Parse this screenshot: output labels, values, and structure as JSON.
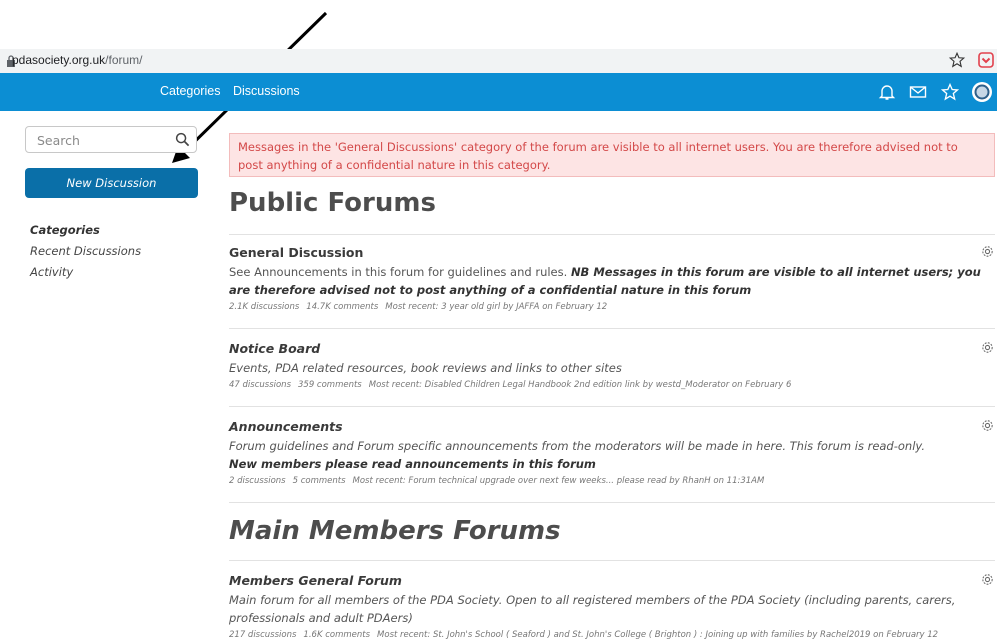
{
  "browser": {
    "url_domain": "pdasociety.org.uk",
    "url_path": "/forum/",
    "lock_icon": "lock-icon",
    "bookmark_icon": "star-outline-icon",
    "extension_icon": "pocket-icon"
  },
  "nav": {
    "categories": "Categories",
    "discussions": "Discussions",
    "icons": [
      "bell-icon",
      "envelope-icon",
      "star-icon",
      "avatar-icon"
    ],
    "bg_color": "#0c8ed3"
  },
  "sidebar": {
    "search_placeholder": "Search",
    "new_discussion": "New Discussion",
    "links": [
      "Categories",
      "Recent Discussions",
      "Activity"
    ],
    "active_link": "Categories"
  },
  "alert": {
    "text": "Messages in the 'General Discussions' category of the forum are visible to all internet users. You are therefore advised not to post anything of a confidential nature in this category."
  },
  "sections": [
    {
      "title": "Public Forums",
      "categories": [
        {
          "title": "General Discussion",
          "desc_plain": "See Announcements in this forum for guidelines and rules. ",
          "desc_bold": "NB Messages in this forum are visible to all internet users; you are therefore advised not to post anything of a confidential nature in this forum",
          "discussions": "2.1K discussions",
          "comments": "14.7K comments",
          "recent": "Most recent: 3 year old girl by JAFFA on February 12"
        },
        {
          "title": "Notice Board",
          "desc": "Events, PDA related resources, book reviews and links to other sites",
          "discussions": "47 discussions",
          "comments": "359 comments",
          "recent": "Most recent: Disabled Children Legal Handbook 2nd edition link by westd_Moderator on February 6"
        },
        {
          "title": "Announcements",
          "desc": "Forum guidelines and Forum specific announcements from the moderators will be made in here. This forum is read-only.",
          "desc_bold": "New members please read announcements in this forum",
          "discussions": "2 discussions",
          "comments": "5 comments",
          "recent": "Most recent: Forum technical upgrade over next few weeks... please read by RhanH on 11:31AM"
        }
      ]
    },
    {
      "title": "Main Members Forums",
      "categories": [
        {
          "title": "Members General Forum",
          "desc": "Main forum for all members of the PDA Society. Open to all registered members of the PDA Society (including parents, carers, professionals and adult PDAers)",
          "discussions": "217 discussions",
          "comments": "1.6K comments",
          "recent": "Most recent: St. John's School ( Seaford ) and St. John's College ( Brighton ) : Joining up with families by Rachel2019 on February 12"
        }
      ]
    }
  ],
  "gear_icon": "gear-icon",
  "annotation": {
    "arrow_icon": "arrow-annotation-icon"
  }
}
